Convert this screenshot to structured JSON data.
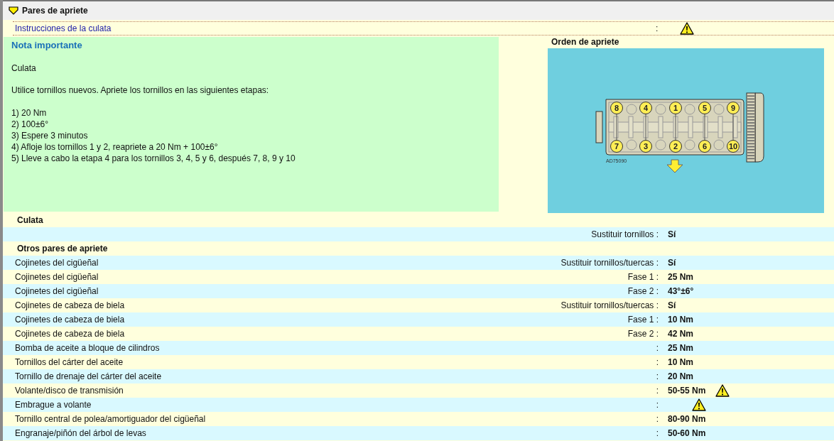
{
  "title_bar": {
    "title": "Pares de apriete"
  },
  "instructions": {
    "link": "Instrucciones de la culata",
    "separator": ":",
    "warning": true
  },
  "note": {
    "title": "Nota importante",
    "paragraphs": [
      "Culata",
      "Utilice tornillos nuevos. Apriete los tornillos en las siguientes etapas:"
    ],
    "steps": [
      "1) 20 Nm",
      "2) 100±6°",
      "3) Espere 3 minutos",
      "4) Afloje los tornillos 1 y 2, reapriete a 20 Nm + 100±6°",
      "5) Lleve a cabo la etapa 4 para los tornillos 3, 4, 5 y 6, después 7, 8, 9 y 10"
    ]
  },
  "diagram": {
    "title": "Orden de apriete",
    "top_bolts": [
      "8",
      "4",
      "1",
      "5",
      "9"
    ],
    "bottom_bolts": [
      "7",
      "3",
      "2",
      "6",
      "10"
    ],
    "code": "AD75090"
  },
  "rows": [
    {
      "kind": "section",
      "label": "Culata"
    },
    {
      "kind": "item",
      "label": "",
      "param": "Sustituir tornillos :",
      "value": "Sí",
      "warning": false
    },
    {
      "kind": "section",
      "label": "Otros pares de apriete"
    },
    {
      "kind": "item",
      "label": "Cojinetes del cigüeñal",
      "param": "Sustituir tornillos/tuercas :",
      "value": "Sí",
      "warning": false
    },
    {
      "kind": "item",
      "label": "Cojinetes del cigüeñal",
      "param": "Fase 1 :",
      "value": "25 Nm",
      "warning": false
    },
    {
      "kind": "item",
      "label": "Cojinetes del cigüeñal",
      "param": "Fase 2 :",
      "value": "43°±6°",
      "warning": false
    },
    {
      "kind": "item",
      "label": "Cojinetes de cabeza de biela",
      "param": "Sustituir tornillos/tuercas :",
      "value": "Sí",
      "warning": false
    },
    {
      "kind": "item",
      "label": "Cojinetes de cabeza de biela",
      "param": "Fase 1 :",
      "value": "10 Nm",
      "warning": false
    },
    {
      "kind": "item",
      "label": "Cojinetes de cabeza de biela",
      "param": "Fase 2 :",
      "value": "42 Nm",
      "warning": false
    },
    {
      "kind": "item",
      "label": "Bomba de aceite a bloque de cilindros",
      "param": ":",
      "value": "25 Nm",
      "warning": false
    },
    {
      "kind": "item",
      "label": "Tornillos del cárter del aceite",
      "param": ":",
      "value": "10 Nm",
      "warning": false
    },
    {
      "kind": "item",
      "label": "Tornillo de drenaje del cárter del aceite",
      "param": ":",
      "value": "20 Nm",
      "warning": false
    },
    {
      "kind": "item",
      "label": "Volante/disco de transmisión",
      "param": ":",
      "value": "50-55 Nm",
      "warning": true
    },
    {
      "kind": "item",
      "label": "Embrague a volante",
      "param": ":",
      "value": "",
      "warning": true
    },
    {
      "kind": "item",
      "label": "Tornillo central de polea/amortiguador del cigüeñal",
      "param": ":",
      "value": "80-90 Nm",
      "warning": false
    },
    {
      "kind": "item",
      "label": "Engranaje/piñón del árbol de levas",
      "param": ":",
      "value": "50-60 Nm",
      "warning": false
    }
  ]
}
